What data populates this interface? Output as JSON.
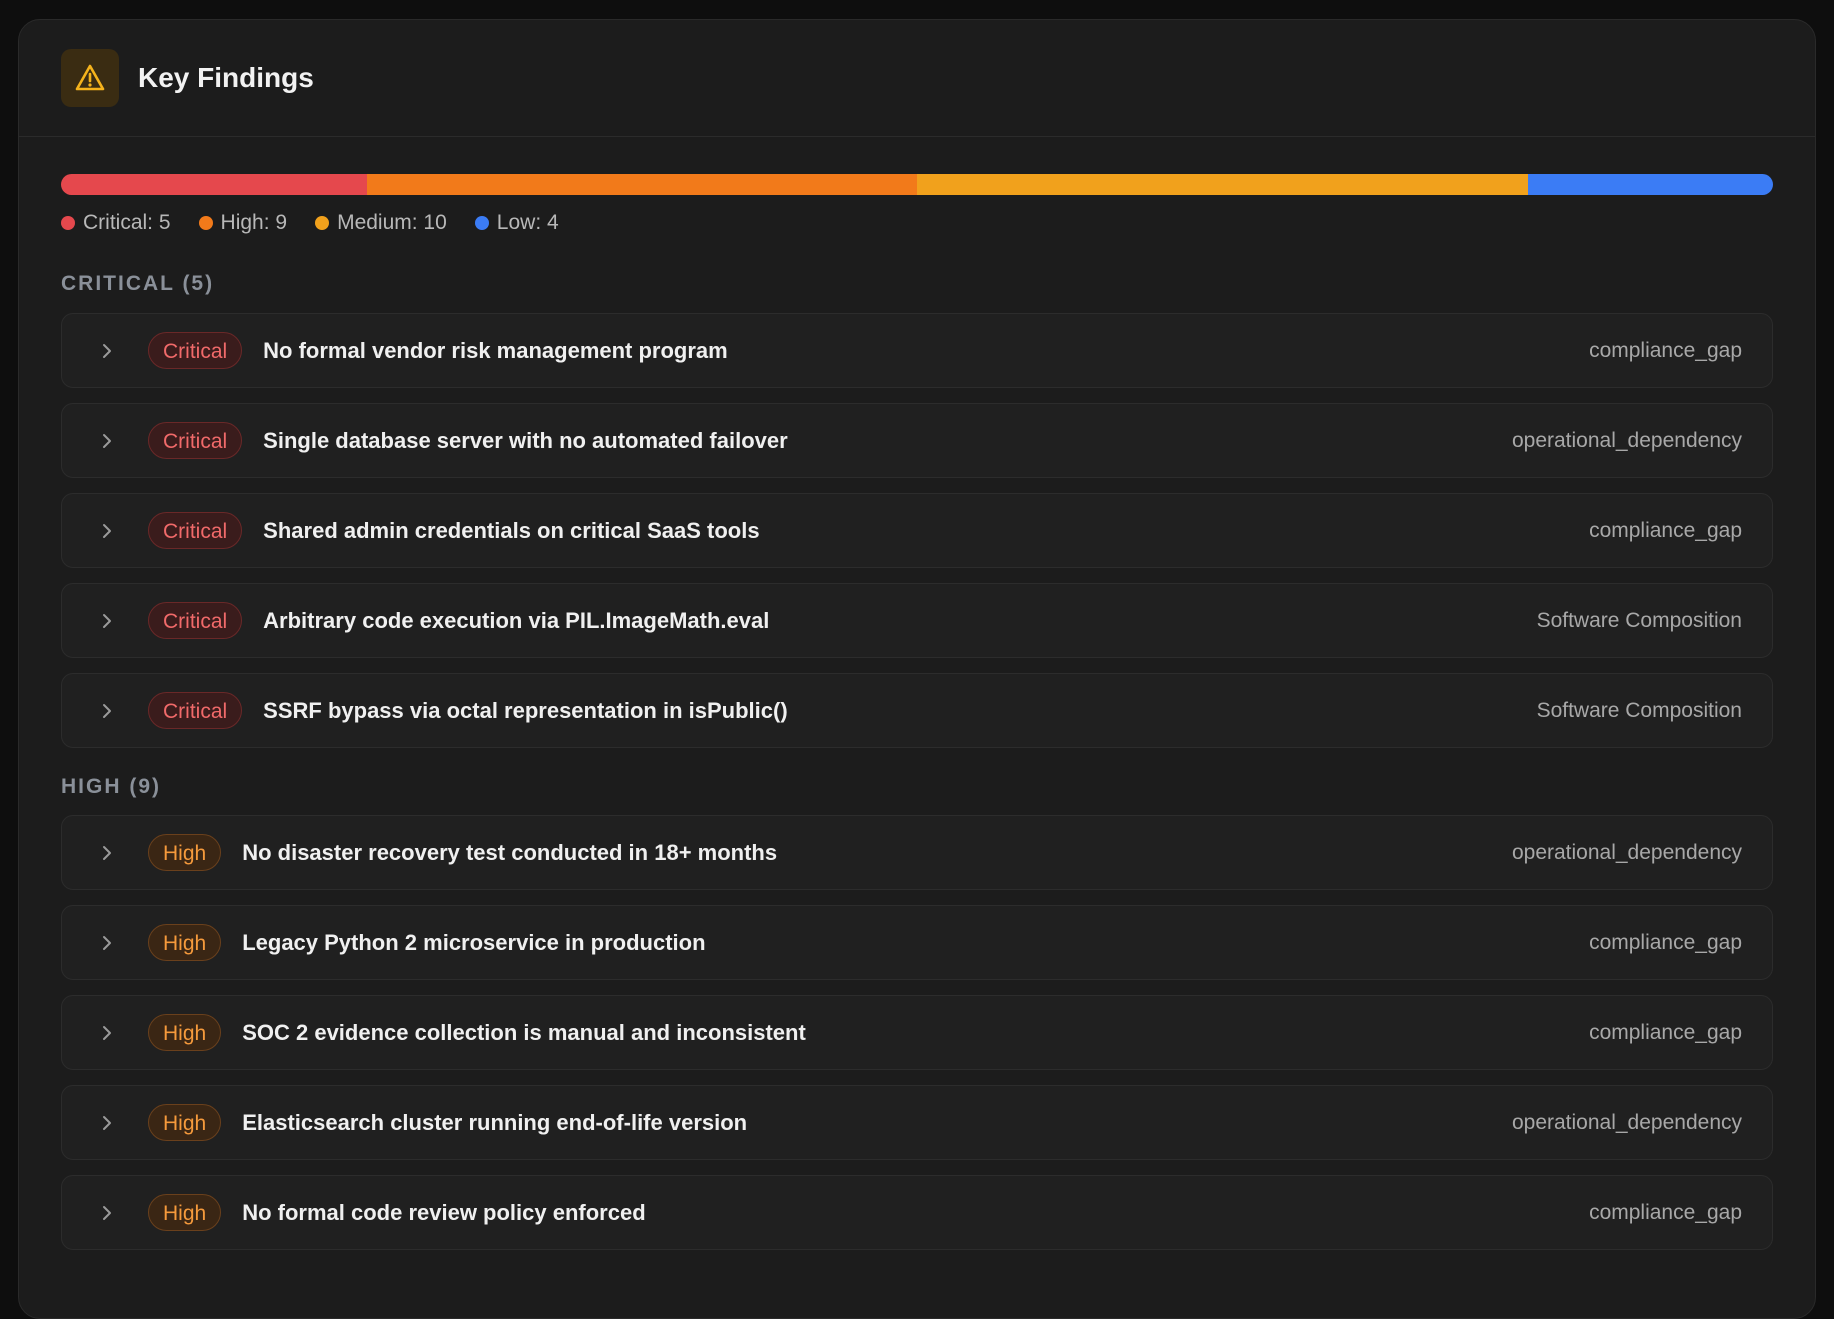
{
  "panel": {
    "title": "Key Findings",
    "icon": "warning-icon",
    "accent": "#f5b31c"
  },
  "severity_summary": {
    "segments": [
      {
        "name": "Critical",
        "count": 5,
        "color": "#e5484d"
      },
      {
        "name": "High",
        "count": 9,
        "color": "#f27a1a"
      },
      {
        "name": "Medium",
        "count": 10,
        "color": "#f1a11c"
      },
      {
        "name": "Low",
        "count": 4,
        "color": "#3b7cf5"
      }
    ],
    "legend": [
      {
        "label": "Critical: 5",
        "color": "#e5484d"
      },
      {
        "label": "High: 9",
        "color": "#f27a1a"
      },
      {
        "label": "Medium: 10",
        "color": "#f1a11c"
      },
      {
        "label": "Low: 4",
        "color": "#3b7cf5"
      }
    ]
  },
  "sections": [
    {
      "label": "CRITICAL (5)",
      "badge": "Critical",
      "findings": [
        {
          "title": "No formal vendor risk management program",
          "category": "compliance_gap"
        },
        {
          "title": "Single database server with no automated failover",
          "category": "operational_dependency"
        },
        {
          "title": "Shared admin credentials on critical SaaS tools",
          "category": "compliance_gap"
        },
        {
          "title": "Arbitrary code execution via PIL.ImageMath.eval",
          "category": "Software Composition"
        },
        {
          "title": "SSRF bypass via octal representation in isPublic()",
          "category": "Software Composition"
        }
      ]
    },
    {
      "label": "HIGH (9)",
      "badge": "High",
      "findings": [
        {
          "title": "No disaster recovery test conducted in 18+ months",
          "category": "operational_dependency"
        },
        {
          "title": "Legacy Python 2 microservice in production",
          "category": "compliance_gap"
        },
        {
          "title": "SOC 2 evidence collection is manual and inconsistent",
          "category": "compliance_gap"
        },
        {
          "title": "Elasticsearch cluster running end-of-life version",
          "category": "operational_dependency"
        },
        {
          "title": "No formal code review policy enforced",
          "category": "compliance_gap"
        }
      ]
    }
  ]
}
